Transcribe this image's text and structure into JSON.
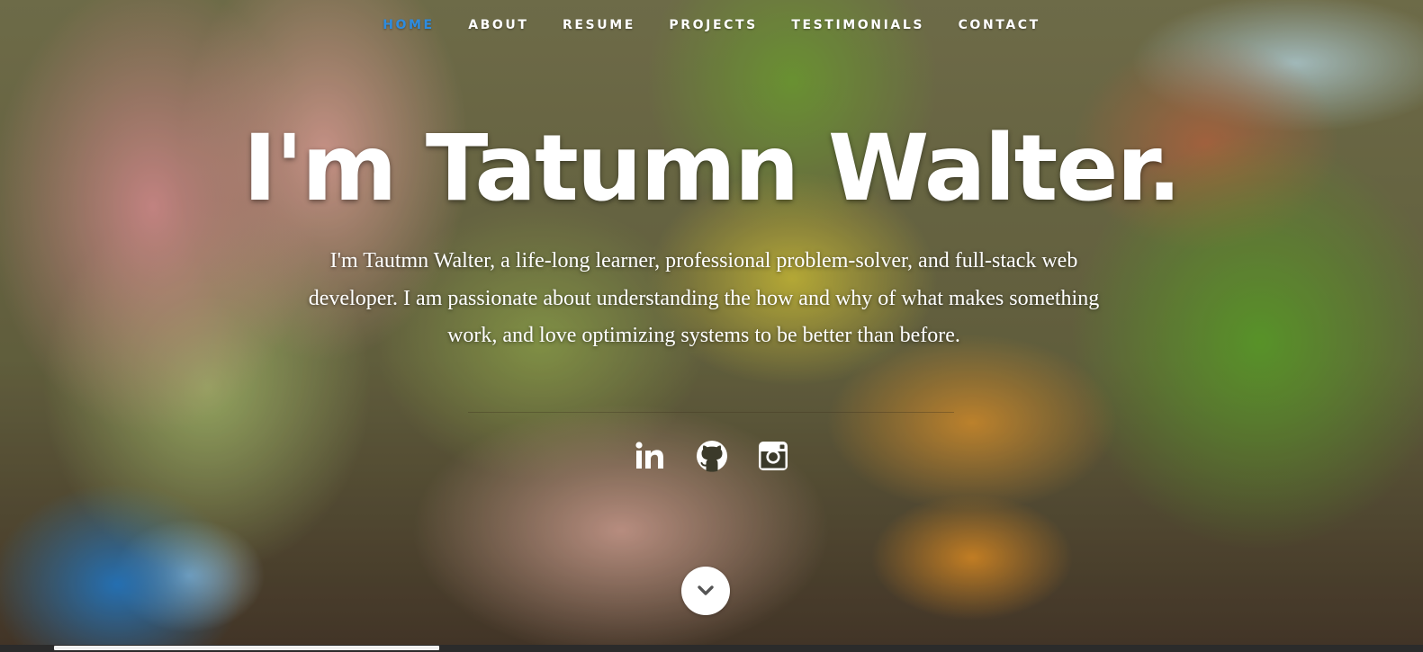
{
  "nav": {
    "items": [
      {
        "label": "HOME",
        "active": true
      },
      {
        "label": "ABOUT",
        "active": false
      },
      {
        "label": "RESUME",
        "active": false
      },
      {
        "label": "PROJECTS",
        "active": false
      },
      {
        "label": "TESTIMONIALS",
        "active": false
      },
      {
        "label": "CONTACT",
        "active": false
      }
    ]
  },
  "banner": {
    "headline": "I'm Tatumn Walter.",
    "bio": "I'm Tautmn Walter, a life-long learner, professional problem-solver, and full-stack web developer. I am passionate about understanding the how and why of what makes something work, and love optimizing systems to be better than before."
  },
  "social": {
    "icons": [
      "linkedin-icon",
      "github-icon",
      "instagram-icon"
    ]
  },
  "scroll_down": {
    "icon": "chevron-down-icon"
  },
  "colors": {
    "accent": "#2d8ce0",
    "text": "#ffffff"
  }
}
